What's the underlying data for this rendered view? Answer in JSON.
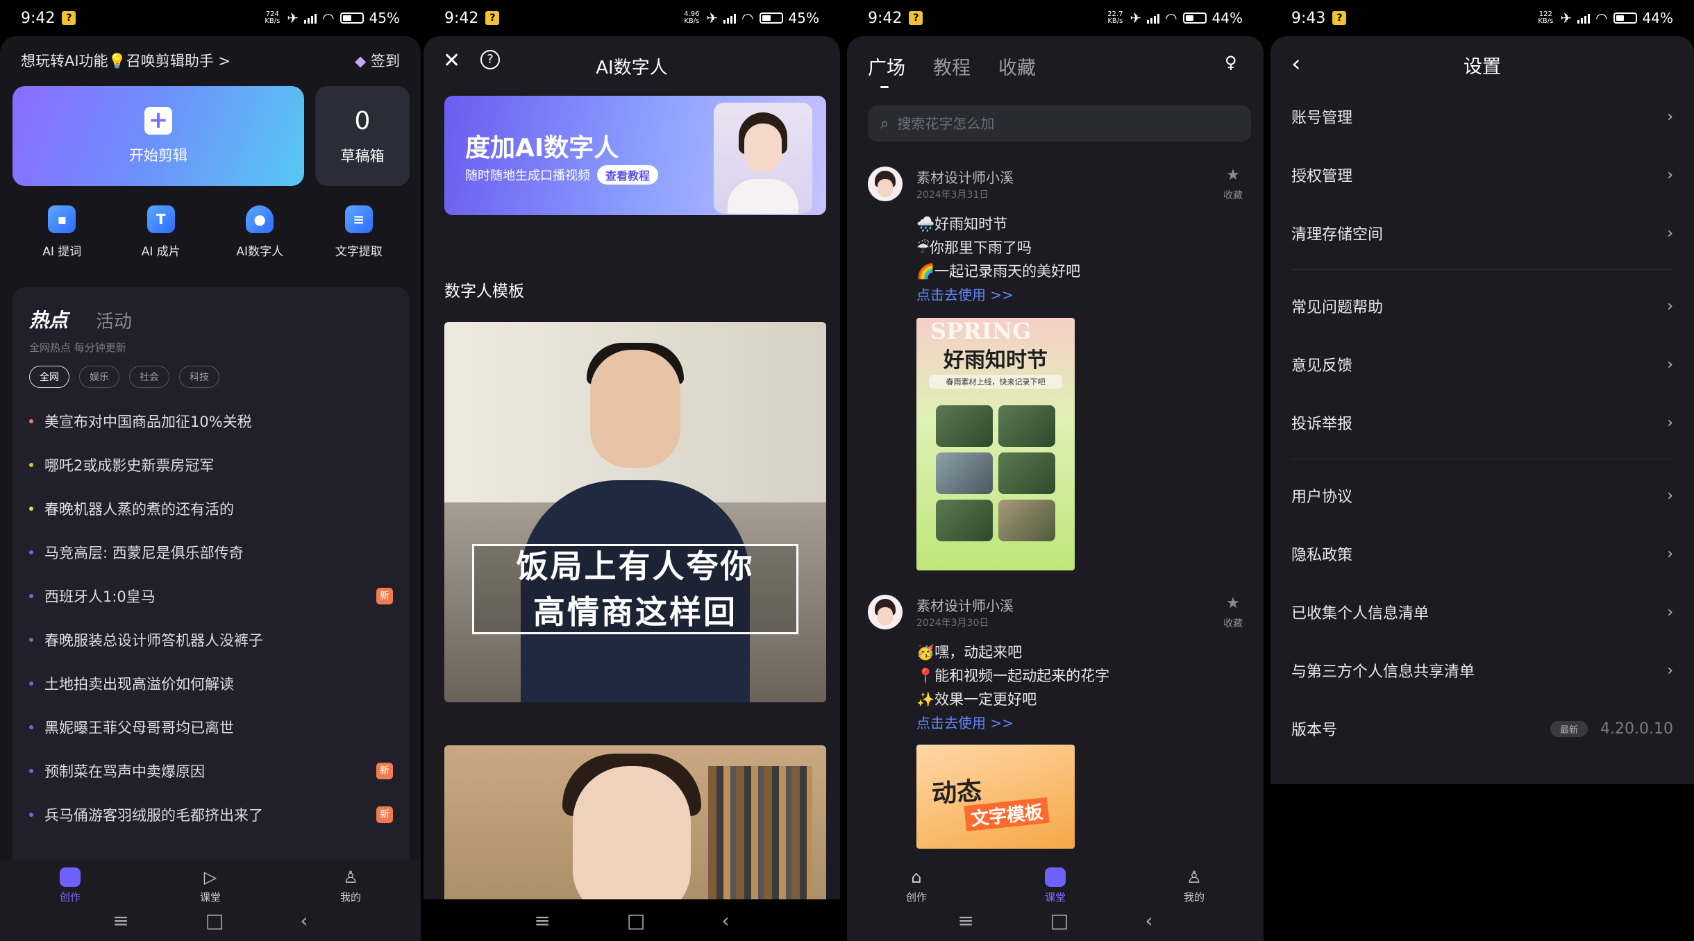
{
  "colors": {
    "accent": "#7b6cff",
    "link": "#5f86ff",
    "new_tag": "#f07b4c",
    "panel": "#1c1b21"
  },
  "screens": [
    {
      "status": {
        "time": "9:42",
        "speed": "724 KB/s",
        "battery": "45%",
        "battery_level": 0.45
      },
      "top_prompt": "想玩转AI功能💡召唤剪辑助手 >",
      "signin_label": "签到",
      "start_edit_label": "开始剪辑",
      "draft": {
        "count": "0",
        "label": "草稿箱"
      },
      "tools": [
        {
          "label": "AI 提词",
          "icon": "ai-prompt-icon"
        },
        {
          "label": "AI 成片",
          "icon": "ai-film-icon"
        },
        {
          "label": "AI数字人",
          "icon": "digital-human-icon"
        },
        {
          "label": "文字提取",
          "icon": "text-extract-icon"
        }
      ],
      "hot": {
        "tab_hot": "热点",
        "tab_activity": "活动",
        "subtitle": "全网热点 每分钟更新",
        "chips": [
          "全网",
          "娱乐",
          "社会",
          "科技"
        ],
        "items": [
          {
            "text": "美宣布对中国商品加征10%关税",
            "new": false,
            "dot": "#f07b4c"
          },
          {
            "text": "哪吒2或成影史新票房冠军",
            "new": false,
            "dot": "#f3b43c"
          },
          {
            "text": "春晚机器人蒸的煮的还有活的",
            "new": false,
            "dot": "#f3d33c"
          },
          {
            "text": "马竞高层: 西蒙尼是俱乐部传奇",
            "new": false,
            "dot": "#6b6bd8"
          },
          {
            "text": "西班牙人1:0皇马",
            "new": true,
            "dot": "#6b6bd8"
          },
          {
            "text": "春晚服装总设计师答机器人没裤子",
            "new": false,
            "dot": "#6b6bd8"
          },
          {
            "text": "土地拍卖出现高溢价如何解读",
            "new": false,
            "dot": "#6b6bd8"
          },
          {
            "text": "黑妮曝王菲父母哥哥均已离世",
            "new": false,
            "dot": "#6b6bd8"
          },
          {
            "text": "预制菜在骂声中卖爆原因",
            "new": true,
            "dot": "#6b6bd8"
          },
          {
            "text": "兵马俑游客羽绒服的毛都挤出来了",
            "new": true,
            "dot": "#6b6bd8"
          }
        ],
        "new_label": "新"
      },
      "nav": [
        "创作",
        "课堂",
        "我的"
      ],
      "nav_active": 0
    },
    {
      "status": {
        "time": "9:42",
        "speed": "4.96 KB/s",
        "battery": "45%",
        "battery_level": 0.45
      },
      "title": "AI数字人",
      "banner": {
        "title": "度加AI数字人",
        "subtitle": "随时随地生成口播视频",
        "button": "查看教程"
      },
      "section_title": "数字人模板",
      "template1_caption": [
        "饭局上有人夸你",
        "高情商这样回"
      ]
    },
    {
      "status": {
        "time": "9:42",
        "speed": "22.7 KB/s",
        "battery": "44%",
        "battery_level": 0.44
      },
      "tabs": [
        "广场",
        "教程",
        "收藏"
      ],
      "active_tab": 0,
      "search_placeholder": "搜索花字怎么加",
      "posts": [
        {
          "author": "素材设计师小溪",
          "date": "2024年3月31日",
          "fav": "收藏",
          "lines": [
            "🌧️好雨知时节",
            "☔你那里下雨了吗",
            "🌈一起记录雨天的美好吧"
          ],
          "link": "点击去使用 >>",
          "card_title": "好雨知时节",
          "card_spring": "SPRING",
          "card_sub": "春雨素材上线，快来记录下吧"
        },
        {
          "author": "素材设计师小溪",
          "date": "2024年3月30日",
          "fav": "收藏",
          "lines": [
            "🥳嘿，动起来吧",
            "📍能和视频一起动起来的花字",
            "✨效果一定更好吧"
          ],
          "link": "点击去使用 >>",
          "card_title": "动态",
          "card_sub": "文字模板"
        }
      ],
      "nav": [
        "创作",
        "课堂",
        "我的"
      ],
      "nav_active": 1
    },
    {
      "status": {
        "time": "9:43",
        "speed": "122 KB/s",
        "battery": "44%",
        "battery_level": 0.44
      },
      "title": "设置",
      "groups": [
        [
          "账号管理",
          "授权管理",
          "清理存储空间"
        ],
        [
          "常见问题帮助",
          "意见反馈",
          "投诉举报"
        ],
        [
          "用户协议",
          "隐私政策",
          "已收集个人信息清单",
          "与第三方个人信息共享清单"
        ]
      ],
      "version_label": "版本号",
      "version_tag": "最新",
      "version": "4.20.0.10"
    }
  ]
}
